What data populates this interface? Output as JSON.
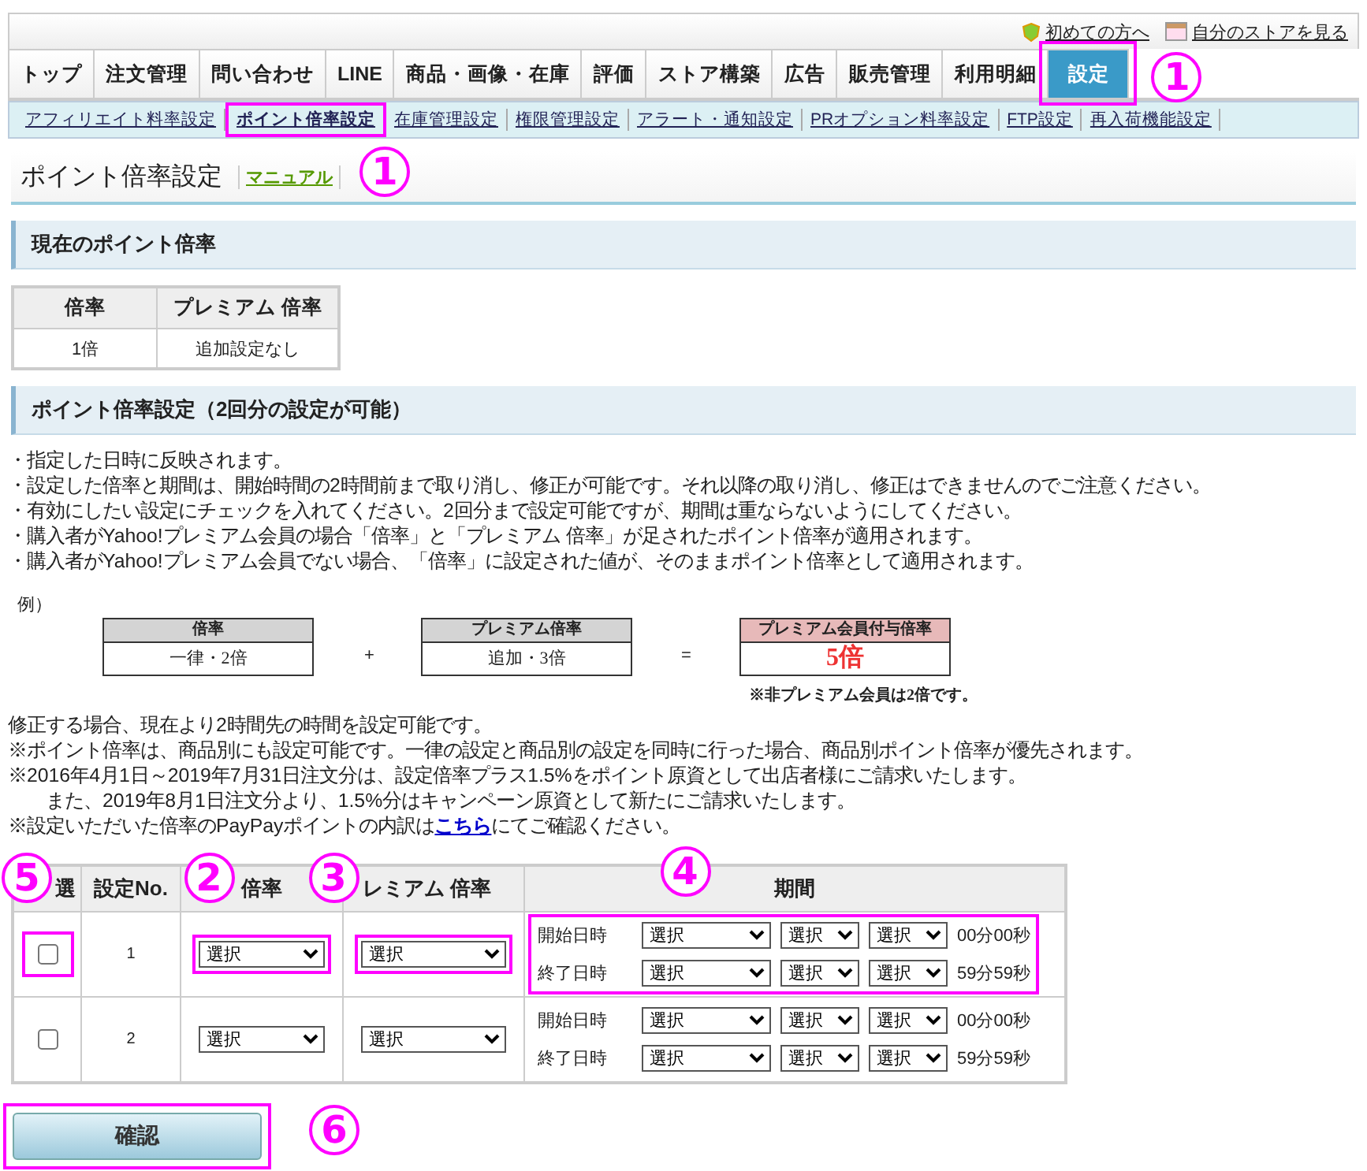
{
  "header_links": [
    {
      "label": "初めての方へ"
    },
    {
      "label": "自分のストアを見る"
    }
  ],
  "tabs": [
    {
      "label": "トップ",
      "selected": false,
      "highlighted": false
    },
    {
      "label": "注文管理",
      "selected": false,
      "highlighted": false
    },
    {
      "label": "問い合わせ",
      "selected": false,
      "highlighted": false
    },
    {
      "label": "LINE",
      "selected": false,
      "highlighted": false
    },
    {
      "label": "商品・画像・在庫",
      "selected": false,
      "highlighted": false
    },
    {
      "label": "評価",
      "selected": false,
      "highlighted": false
    },
    {
      "label": "ストア構築",
      "selected": false,
      "highlighted": false
    },
    {
      "label": "広告",
      "selected": false,
      "highlighted": false
    },
    {
      "label": "販売管理",
      "selected": false,
      "highlighted": false
    },
    {
      "label": "利用明細",
      "selected": false,
      "highlighted": false
    },
    {
      "label": "設定",
      "selected": true,
      "highlighted": true
    }
  ],
  "subtabs": [
    {
      "label": "アフィリエイト料率設定",
      "selected": false,
      "highlighted": false
    },
    {
      "label": "ポイント倍率設定",
      "selected": true,
      "highlighted": true
    },
    {
      "label": "在庫管理設定",
      "selected": false,
      "highlighted": false
    },
    {
      "label": "権限管理設定",
      "selected": false,
      "highlighted": false
    },
    {
      "label": "アラート・通知設定",
      "selected": false,
      "highlighted": false
    },
    {
      "label": "PRオプション料率設定",
      "selected": false,
      "highlighted": false
    },
    {
      "label": "FTP設定",
      "selected": false,
      "highlighted": false
    },
    {
      "label": "再入荷機能設定",
      "selected": false,
      "highlighted": false
    }
  ],
  "page_title": "ポイント倍率設定",
  "manual_link": "マニュアル",
  "current": {
    "heading": "現在のポイント倍率",
    "columns": [
      "倍率",
      "プレミアム 倍率"
    ],
    "row": [
      "1倍",
      "追加設定なし"
    ]
  },
  "settings": {
    "heading": "ポイント倍率設定（2回分の設定が可能）",
    "bullets": [
      "・指定した日時に反映されます。",
      "・設定した倍率と期間は、開始時間の2時間前まで取り消し、修正が可能です。それ以降の取り消し、修正はできませんのでご注意ください。",
      "・有効にしたい設定にチェックを入れてください。2回分まで設定可能ですが、期間は重ならないようにしてください。",
      "・購入者がYahoo!プレミアム会員の場合「倍率」と「プレミアム 倍率」が足されたポイント倍率が適用されます。",
      "・購入者がYahoo!プレミアム会員でない場合、「倍率」に設定された値が、そのままポイント倍率として適用されます。"
    ],
    "example": {
      "label": "例）",
      "operators": [
        "+",
        "="
      ],
      "boxes": [
        {
          "kind": "plain",
          "header": "倍率",
          "value": "一律・2倍"
        },
        {
          "kind": "plain",
          "header": "プレミアム倍率",
          "value": "追加・3倍"
        },
        {
          "kind": "result",
          "header": "プレミアム会員付与倍率",
          "value": "5倍"
        }
      ],
      "note": "※非プレミアム会員は2倍です。"
    },
    "notes": [
      {
        "kind": "plain",
        "text": "修正する場合、現在より2時間先の時間を設定可能です。"
      },
      {
        "kind": "plain",
        "text": "※ポイント倍率は、商品別にも設定可能です。一律の設定と商品別の設定を同時に行った場合、商品別ポイント倍率が優先されます。"
      },
      {
        "kind": "plain",
        "text": "※2016年4月1日～2019年7月31日注文分は、設定倍率プラス1.5%をポイント原資として出店者様にご請求いたします。"
      },
      {
        "kind": "indent",
        "text": "また、2019年8月1日注文分より、1.5%分はキャンペーン原資として新たにご請求いたします。"
      },
      {
        "kind": "link",
        "text": "※設定いただいた倍率のPayPayポイントの内訳は",
        "link": "こちら",
        "after": "にてご確認ください。"
      }
    ]
  },
  "table": {
    "columns": [
      "選",
      "設定No.",
      "倍率",
      "レミアム 倍率",
      "期間"
    ],
    "rows": [
      {
        "no": "1",
        "checked": false,
        "checkbox_highlighted": true,
        "rate": {
          "value": "選択",
          "highlighted": true
        },
        "premium": {
          "value": "選択",
          "highlighted": true
        },
        "period": {
          "highlighted": true,
          "start_label": "開始日時",
          "start": [
            "選択",
            "選択",
            "選択"
          ],
          "start_suffix": "00分00秒",
          "end_label": "終了日時",
          "end": [
            "選択",
            "選択",
            "選択"
          ],
          "end_suffix": "59分59秒"
        }
      },
      {
        "no": "2",
        "checked": false,
        "checkbox_highlighted": false,
        "rate": {
          "value": "選択",
          "highlighted": false
        },
        "premium": {
          "value": "選択",
          "highlighted": false
        },
        "period": {
          "highlighted": false,
          "start_label": "開始日時",
          "start": [
            "選択",
            "選択",
            "選択"
          ],
          "start_suffix": "00分00秒",
          "end_label": "終了日時",
          "end": [
            "選択",
            "選択",
            "選択"
          ],
          "end_suffix": "59分59秒"
        }
      }
    ]
  },
  "confirm_button": {
    "label": "確認",
    "highlighted": true
  },
  "annotations": [
    {
      "label": "1"
    },
    {
      "label": "1"
    },
    {
      "label": "5"
    },
    {
      "label": "2"
    },
    {
      "label": "3"
    },
    {
      "label": "4"
    },
    {
      "label": "6"
    }
  ]
}
